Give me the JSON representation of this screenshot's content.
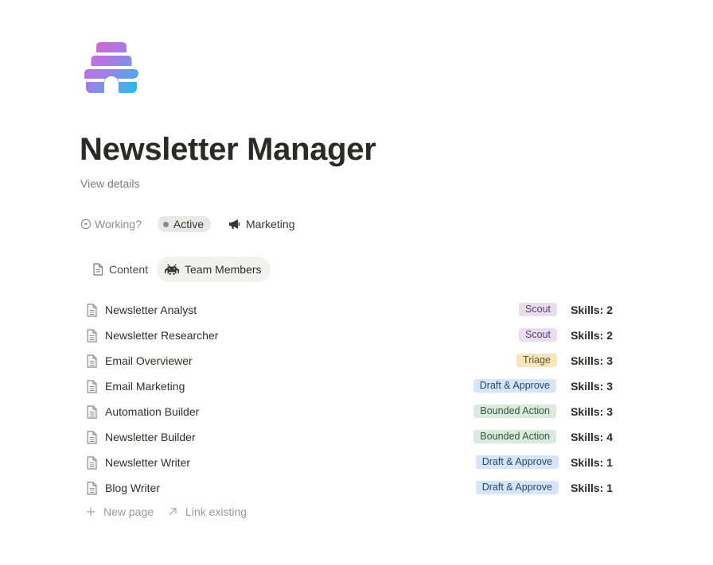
{
  "page": {
    "title": "Newsletter Manager",
    "view_details": "View details"
  },
  "properties": {
    "working_label": "Working?",
    "status": "Active",
    "team": "Marketing"
  },
  "tabs": [
    {
      "label": "Content",
      "icon": "document-icon",
      "active": false
    },
    {
      "label": "Team Members",
      "icon": "space-invader-icon",
      "active": true
    }
  ],
  "rows": [
    {
      "title": "Newsletter Analyst",
      "tag": "Scout",
      "tag_color": "purple",
      "skills": "Skills: 2"
    },
    {
      "title": "Newsletter Researcher",
      "tag": "Scout",
      "tag_color": "purple",
      "skills": "Skills: 2"
    },
    {
      "title": "Email Overviewer",
      "tag": "Triage",
      "tag_color": "yellow",
      "skills": "Skills: 3"
    },
    {
      "title": "Email Marketing",
      "tag": "Draft & Approve",
      "tag_color": "blue",
      "skills": "Skills: 3"
    },
    {
      "title": "Automation Builder",
      "tag": "Bounded Action",
      "tag_color": "green",
      "skills": "Skills: 3"
    },
    {
      "title": "Newsletter Builder",
      "tag": "Bounded Action",
      "tag_color": "green",
      "skills": "Skills: 4"
    },
    {
      "title": "Newsletter Writer",
      "tag": "Draft & Approve",
      "tag_color": "blue",
      "skills": "Skills: 1"
    },
    {
      "title": "Blog Writer",
      "tag": "Draft & Approve",
      "tag_color": "blue",
      "skills": "Skills: 1"
    }
  ],
  "tag_colors": {
    "purple": {
      "bg": "#e8deee",
      "fg": "#5a3e6b"
    },
    "yellow": {
      "bg": "#f6e6c0",
      "fg": "#6b5220"
    },
    "blue": {
      "bg": "#d6e6f8",
      "fg": "#28456c"
    },
    "green": {
      "bg": "#dbe9df",
      "fg": "#2f5a40"
    }
  },
  "footer": {
    "new_page": "New page",
    "link_existing": "Link existing"
  }
}
